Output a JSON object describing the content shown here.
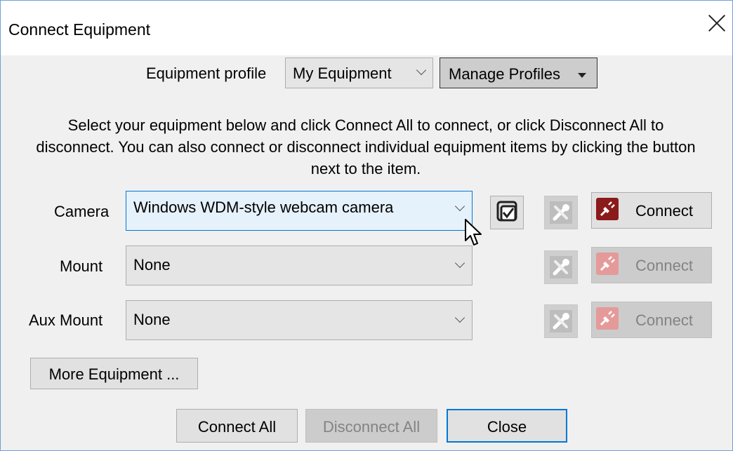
{
  "window": {
    "title": "Connect Equipment"
  },
  "profile": {
    "label": "Equipment profile",
    "selected": "My Equipment",
    "manage_label": "Manage Profiles"
  },
  "description": "Select your equipment below and click Connect All to connect, or click Disconnect All to disconnect. You can also connect or disconnect individual equipment items by clicking the button next to the item.",
  "rows": [
    {
      "label": "Camera",
      "value": "Windows WDM-style webcam camera",
      "connect_label": "Connect",
      "enabled": true
    },
    {
      "label": "Mount",
      "value": "None",
      "connect_label": "Connect",
      "enabled": false
    },
    {
      "label": "Aux Mount",
      "value": "None",
      "connect_label": "Connect",
      "enabled": false
    }
  ],
  "more_equipment_label": "More Equipment ...",
  "footer": {
    "connect_all": "Connect All",
    "disconnect_all": "Disconnect All",
    "close": "Close"
  },
  "colors": {
    "accent": "#0078d7",
    "connect_icon_active": "#8b1a1a",
    "connect_icon_disabled": "#e59a9a"
  },
  "icons": [
    "close-icon",
    "chevron-down-icon",
    "dropdown-arrow-icon",
    "checkbox-select-icon",
    "settings-tools-icon",
    "plug-connect-icon",
    "mouse-cursor-icon"
  ]
}
